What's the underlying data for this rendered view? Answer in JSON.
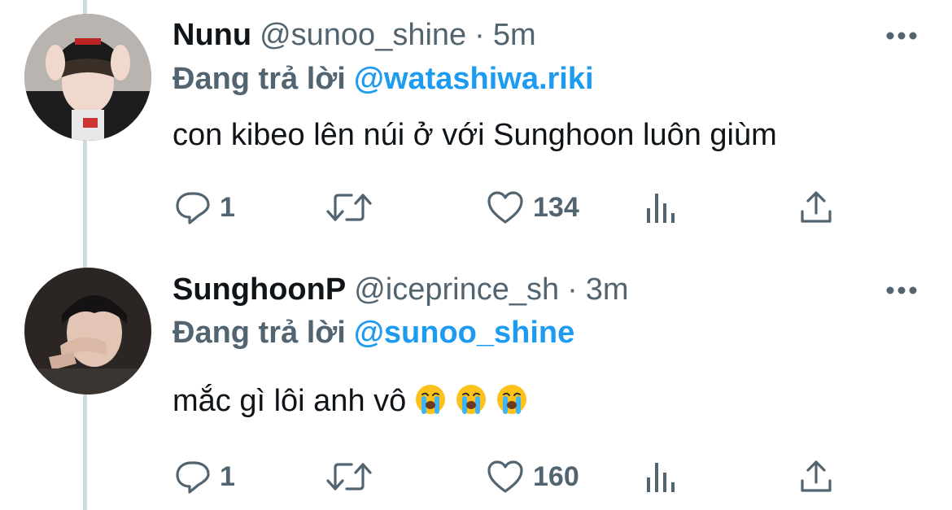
{
  "tweets": [
    {
      "display_name": "Nunu",
      "handle": "@sunoo_shine",
      "separator": "·",
      "time": "5m",
      "reply_label": "Đang trả lời",
      "reply_to": "@watashiwa.riki",
      "text": "con kibeo lên núi ở với Sunghoon luôn giùm",
      "emojis": [],
      "reply_count": "1",
      "like_count": "134"
    },
    {
      "display_name": "SunghoonP",
      "handle": "@iceprince_sh",
      "separator": "·",
      "time": "3m",
      "reply_label": "Đang trả lời",
      "reply_to": "@sunoo_shine",
      "text": "mắc gì lôi anh vô",
      "emojis": [
        "loudly-crying-face-emoji",
        "loudly-crying-face-emoji",
        "loudly-crying-face-emoji"
      ],
      "reply_count": "1",
      "like_count": "160"
    }
  ],
  "icons": {
    "more": "more-horizontal-icon",
    "reply": "reply-bubble-icon",
    "retweet": "retweet-icon",
    "like": "heart-icon",
    "views": "analytics-bars-icon",
    "share": "share-upload-icon"
  },
  "colors": {
    "text": "#0f1419",
    "secondary": "#536471",
    "link": "#1d9bf0",
    "thread_line": "#cfd9de"
  }
}
